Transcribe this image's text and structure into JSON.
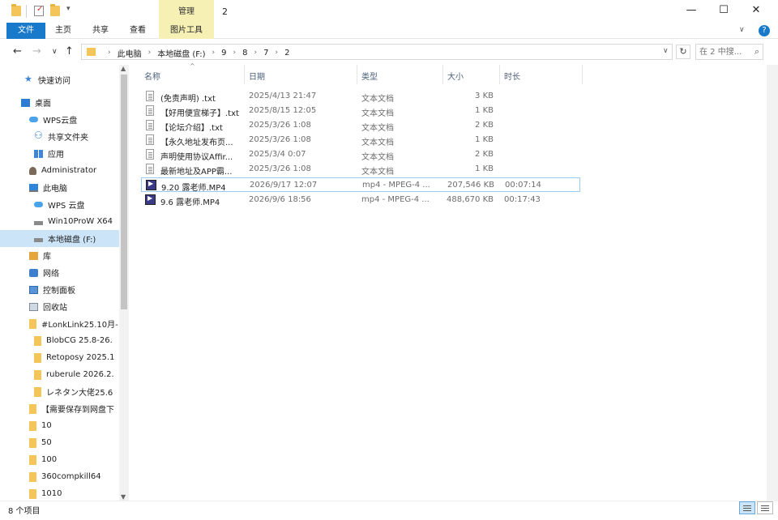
{
  "window": {
    "title": "2",
    "contextual_tab_group": "管理",
    "controls": {
      "minimize": "—",
      "maximize": "☐",
      "close": "✕"
    }
  },
  "ribbon": {
    "file": "文件",
    "tabs": [
      "主页",
      "共享",
      "查看"
    ],
    "contextual_tab": "图片工具",
    "collapse_icon": "chevron-up-icon",
    "help_icon": "help-icon"
  },
  "address": {
    "crumbs": [
      "此电脑",
      "本地磁盘 (F:)",
      "9",
      "8",
      "7",
      "2"
    ],
    "search_placeholder": "在 2 中搜..."
  },
  "nav": {
    "items": [
      {
        "label": "快速访问",
        "icon": "star-icon"
      },
      {
        "label": "桌面",
        "icon": "desktop-icon"
      },
      {
        "label": "WPS云盘",
        "icon": "cloud-icon"
      },
      {
        "label": "共享文件夹",
        "icon": "share-icon"
      },
      {
        "label": "应用",
        "icon": "apps-icon"
      },
      {
        "label": "Administrator",
        "icon": "user-icon"
      },
      {
        "label": "此电脑",
        "icon": "pc-icon"
      },
      {
        "label": "WPS 云盘",
        "icon": "cloud-icon"
      },
      {
        "label": "Win10ProW X64",
        "icon": "drive-icon"
      },
      {
        "label": "本地磁盘 (F:)",
        "icon": "drive-icon",
        "selected": true
      },
      {
        "label": "库",
        "icon": "library-icon"
      },
      {
        "label": "网络",
        "icon": "network-icon"
      },
      {
        "label": "控制面板",
        "icon": "control-panel-icon"
      },
      {
        "label": "回收站",
        "icon": "recycle-bin-icon"
      },
      {
        "label": "#LonkLink25.10月-",
        "icon": "folder-icon"
      },
      {
        "label": "BlobCG 25.8-26.",
        "icon": "folder-icon"
      },
      {
        "label": "Retoposy 2025.1",
        "icon": "folder-icon"
      },
      {
        "label": "ruberule 2026.2.",
        "icon": "folder-icon"
      },
      {
        "label": "レネタン大佬25.6",
        "icon": "folder-icon"
      },
      {
        "label": "【需要保存到网盘下",
        "icon": "folder-icon"
      },
      {
        "label": "10",
        "icon": "folder-icon"
      },
      {
        "label": "50",
        "icon": "folder-icon"
      },
      {
        "label": "100",
        "icon": "folder-icon"
      },
      {
        "label": "360compkill64",
        "icon": "folder-icon"
      },
      {
        "label": "1010",
        "icon": "folder-icon"
      }
    ]
  },
  "columns": {
    "name": "名称",
    "date": "日期",
    "type": "类型",
    "size": "大小",
    "length": "时长"
  },
  "files": [
    {
      "name": "(免责声明) .txt",
      "date": "2025/4/13 21:47",
      "type": "文本文档",
      "size": "3 KB",
      "length": "",
      "kind": "text-file-icon"
    },
    {
      "name": "【好用便宜梯子】.txt",
      "date": "2025/8/15 12:05",
      "type": "文本文档",
      "size": "1 KB",
      "length": "",
      "kind": "text-file-icon"
    },
    {
      "name": "【论坛介绍】.txt",
      "date": "2025/3/26 1:08",
      "type": "文本文档",
      "size": "2 KB",
      "length": "",
      "kind": "text-file-icon"
    },
    {
      "name": "【永久地址发布页...",
      "date": "2025/3/26 1:08",
      "type": "文本文档",
      "size": "1 KB",
      "length": "",
      "kind": "text-file-icon"
    },
    {
      "name": "声明使用协议Affir...",
      "date": "2025/3/4 0:07",
      "type": "文本文档",
      "size": "2 KB",
      "length": "",
      "kind": "text-file-icon"
    },
    {
      "name": "最新地址及APP霸...",
      "date": "2025/3/26 1:08",
      "type": "文本文档",
      "size": "1 KB",
      "length": "",
      "kind": "text-file-icon"
    },
    {
      "name": "9.20 露老师.MP4",
      "date": "2026/9/17 12:07",
      "type": "mp4 - MPEG-4 ...",
      "size": "207,546 KB",
      "length": "00:07:14",
      "kind": "video-file-icon",
      "focused": true
    },
    {
      "name": "9.6 露老师.MP4",
      "date": "2026/9/6 18:56",
      "type": "mp4 - MPEG-4 ...",
      "size": "488,670 KB",
      "length": "00:17:43",
      "kind": "video-file-icon"
    }
  ],
  "status": {
    "count": "8 个项目"
  }
}
